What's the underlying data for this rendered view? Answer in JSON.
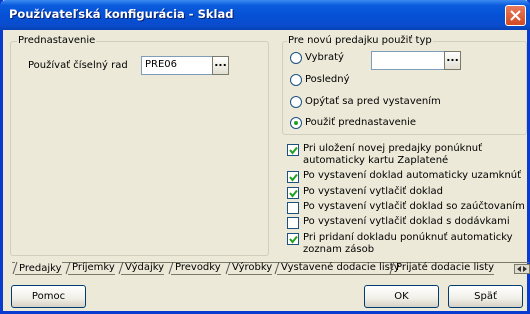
{
  "window": {
    "title": "Používateľská konfigurácia - Sklad"
  },
  "prednastavenie": {
    "legend": "Prednastavenie",
    "label": "Používať číselný rad",
    "value": "PRE06",
    "browse_label": "..."
  },
  "typ": {
    "legend": "Pre novú predajku použiť typ",
    "input_value": "",
    "browse_label": "...",
    "options": [
      {
        "label": "Vybratý",
        "checked": false
      },
      {
        "label": "Posledný",
        "checked": false
      },
      {
        "label": "Opýtať sa pred vystavením",
        "checked": false
      },
      {
        "label": "Použiť prednastavenie",
        "checked": true
      }
    ]
  },
  "checkboxes": [
    {
      "label": "Pri uložení novej predajky ponúknuť automaticky kartu Zaplatené",
      "checked": true
    },
    {
      "label": "Po vystavení doklad automaticky uzamknúť",
      "checked": true
    },
    {
      "label": "Po vystavení vytlačiť doklad",
      "checked": true
    },
    {
      "label": "Po vystavení vytlačiť doklad so zaúčtovaním",
      "checked": false
    },
    {
      "label": "Po vystavení vytlačiť doklad s dodávkami",
      "checked": false
    },
    {
      "label": "Pri pridaní dokladu ponúknuť automaticky zoznam zásob",
      "checked": true
    }
  ],
  "tabs": [
    "Predajky",
    "Príjemky",
    "Výdajky",
    "Prevodky",
    "Výrobky",
    "Vystavené dodacie listy",
    "Prijaté dodacie listy"
  ],
  "active_tab": "Predajky",
  "buttons": {
    "help": "Pomoc",
    "ok": "OK",
    "back": "Späť"
  },
  "colors": {
    "title_bar": "#0551d6",
    "window_bg": "#ece9d8",
    "radio_dot": "#21a121",
    "check_mark": "#21a121"
  }
}
